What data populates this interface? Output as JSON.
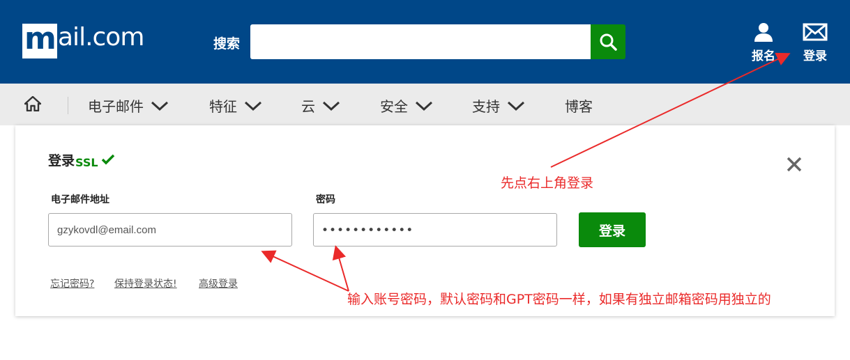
{
  "header": {
    "logo": {
      "mark": "m",
      "rest": "ail.com"
    },
    "search": {
      "label": "搜索",
      "placeholder": "",
      "value": ""
    },
    "actions": {
      "register_label": "报名",
      "login_label": "登录"
    },
    "icons": {
      "search": "search-icon",
      "register": "user-icon",
      "login": "envelope-icon"
    }
  },
  "nav": {
    "home_icon": "home-icon",
    "items": [
      {
        "label": "电子邮件",
        "has_dropdown": true
      },
      {
        "label": "特征",
        "has_dropdown": true
      },
      {
        "label": "云",
        "has_dropdown": true
      },
      {
        "label": "安全",
        "has_dropdown": true
      },
      {
        "label": "支持",
        "has_dropdown": true
      },
      {
        "label": "博客",
        "has_dropdown": false
      }
    ]
  },
  "login_card": {
    "title": "登录",
    "ssl": "SSL",
    "email_label": "电子邮件地址",
    "email_value": "gzykovdl@email.com",
    "password_label": "密码",
    "password_mask": "••••••••••••",
    "submit_label": "登录",
    "links": {
      "forgot": "忘记密码?",
      "stay_logged_in": "保持登录状态!",
      "advanced": "高级登录"
    }
  },
  "annotations": {
    "top": "先点右上角登录",
    "bottom": "输入账号密码，默认密码和GPT密码一样，如果有独立邮箱密码用独立的"
  },
  "colors": {
    "header_bg": "#004788",
    "nav_bg": "#ebebeb",
    "accent_green": "#0a8a0c",
    "annotation_red": "#ea2a2a"
  }
}
